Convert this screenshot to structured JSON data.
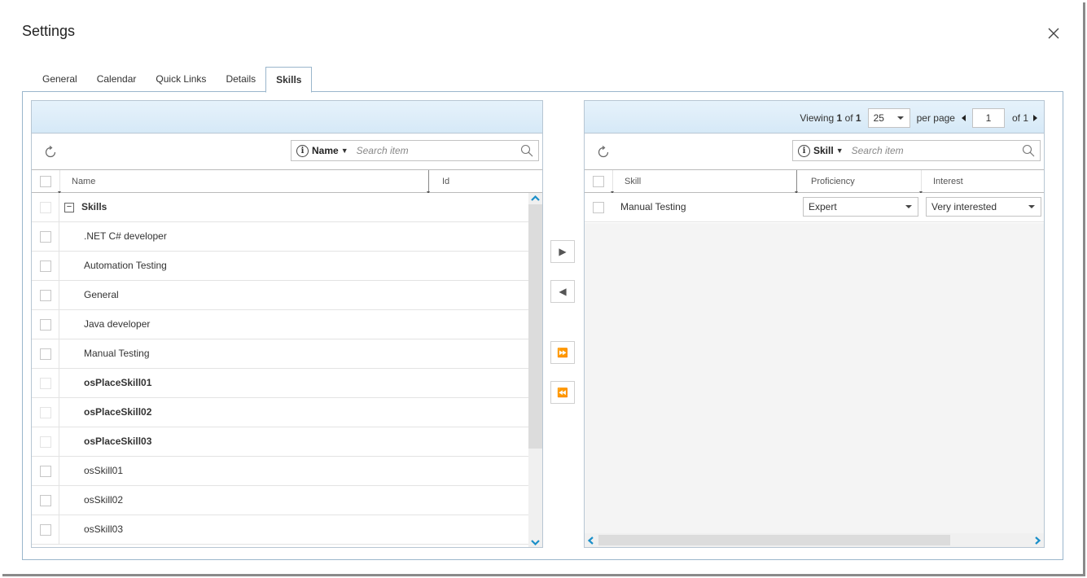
{
  "dialog": {
    "title": "Settings",
    "close_icon": "close-icon"
  },
  "tabs": [
    {
      "label": "General",
      "active": false
    },
    {
      "label": "Calendar",
      "active": false
    },
    {
      "label": "Quick Links",
      "active": false
    },
    {
      "label": "Details",
      "active": false
    },
    {
      "label": "Skills",
      "active": true
    }
  ],
  "left": {
    "search": {
      "field": "Name",
      "placeholder": "Search item"
    },
    "columns": {
      "name": "Name",
      "id": "Id"
    },
    "group": {
      "label": "Skills",
      "toggle": "−"
    },
    "rows": [
      {
        "label": ".NET C# developer",
        "bold": false
      },
      {
        "label": "Automation Testing",
        "bold": false
      },
      {
        "label": "General",
        "bold": false
      },
      {
        "label": "Java developer",
        "bold": false
      },
      {
        "label": "Manual Testing",
        "bold": false
      },
      {
        "label": "osPlaceSkill01",
        "bold": true
      },
      {
        "label": "osPlaceSkill02",
        "bold": true
      },
      {
        "label": "osPlaceSkill03",
        "bold": true
      },
      {
        "label": "osSkill01",
        "bold": false
      },
      {
        "label": "osSkill02",
        "bold": false
      },
      {
        "label": "osSkill03",
        "bold": false
      }
    ]
  },
  "transfer": {
    "move_right": "▶",
    "move_left": "◀",
    "move_all_right": "⏩",
    "move_all_left": "⏪"
  },
  "right": {
    "pager": {
      "viewing_label": "Viewing",
      "page_current": "1",
      "of_label": "of",
      "page_total": "1",
      "per_page_value": "25",
      "per_page_label": "per page",
      "page_input": "1",
      "of_pages": "of 1"
    },
    "search": {
      "field": "Skill",
      "placeholder": "Search item"
    },
    "columns": {
      "skill": "Skill",
      "proficiency": "Proficiency",
      "interest": "Interest"
    },
    "rows": [
      {
        "skill": "Manual Testing",
        "proficiency": "Expert",
        "interest": "Very interested"
      }
    ]
  },
  "colors": {
    "accent": "#1a8fc9",
    "header_gradient_top": "#e6f2fb",
    "header_gradient_bottom": "#d6e9f7"
  }
}
